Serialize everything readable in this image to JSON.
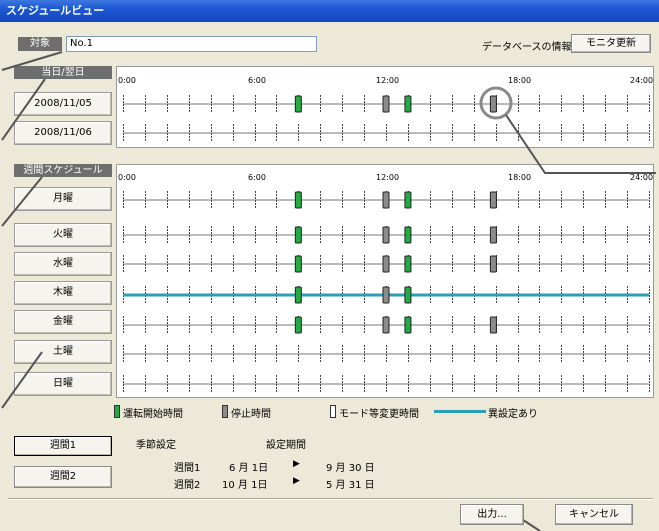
{
  "window": {
    "title": "スケジュールビュー"
  },
  "header": {
    "target_label": "対象",
    "target_value": "No.1",
    "db_info_label": "データベースの情報",
    "monitor_update_button": "モニタ更新"
  },
  "time_axis": {
    "ticks": [
      "0:00",
      "6:00",
      "12:00",
      "18:00",
      "24:00"
    ]
  },
  "today_section": {
    "label": "当日/翌日",
    "rows": [
      {
        "label": "2008/11/05",
        "events": [
          {
            "type": "start",
            "hour": 8.0
          },
          {
            "type": "stop",
            "hour": 12.0
          },
          {
            "type": "start",
            "hour": 13.0
          },
          {
            "type": "stop",
            "hour": 16.9
          }
        ]
      },
      {
        "label": "2008/11/06",
        "events": []
      }
    ]
  },
  "weekly_section": {
    "label": "週間スケジュール",
    "rows": [
      {
        "label": "月曜",
        "events": [
          {
            "type": "start",
            "hour": 8.0
          },
          {
            "type": "stop",
            "hour": 12.0
          },
          {
            "type": "start",
            "hour": 13.0
          },
          {
            "type": "stop",
            "hour": 16.9
          }
        ]
      },
      {
        "label": "火曜",
        "events": [
          {
            "type": "start",
            "hour": 8.0
          },
          {
            "type": "stop",
            "hour": 12.0
          },
          {
            "type": "start",
            "hour": 13.0
          },
          {
            "type": "stop",
            "hour": 16.9
          }
        ]
      },
      {
        "label": "水曜",
        "events": [
          {
            "type": "start",
            "hour": 8.0
          },
          {
            "type": "stop",
            "hour": 12.0
          },
          {
            "type": "start",
            "hour": 13.0
          },
          {
            "type": "stop",
            "hour": 16.9
          }
        ]
      },
      {
        "label": "木曜",
        "abnormal": true,
        "events": [
          {
            "type": "start",
            "hour": 8.0
          },
          {
            "type": "stop",
            "hour": 12.0
          },
          {
            "type": "start",
            "hour": 13.0
          }
        ]
      },
      {
        "label": "金曜",
        "events": [
          {
            "type": "start",
            "hour": 8.0
          },
          {
            "type": "stop",
            "hour": 12.0
          },
          {
            "type": "start",
            "hour": 13.0
          },
          {
            "type": "stop",
            "hour": 16.9
          }
        ]
      },
      {
        "label": "土曜",
        "events": []
      },
      {
        "label": "日曜",
        "events": []
      }
    ]
  },
  "legend": {
    "start": "運転開始時間",
    "stop": "停止時間",
    "mode_change": "モード等変更時間",
    "abnormal": "異設定あり"
  },
  "week_buttons": [
    "週間1",
    "週間2"
  ],
  "season": {
    "label": "季節設定",
    "period_label": "設定期間",
    "rows": [
      {
        "name": "週間1",
        "start": "6 月  1日",
        "arrow": "▶",
        "end": "9 月 30 日"
      },
      {
        "name": "週間2",
        "start": "10 月  1日",
        "arrow": "▶",
        "end": "5 月 31 日"
      }
    ]
  },
  "footer": {
    "output_button": "出力...",
    "cancel_button": "キャンセル"
  },
  "colors": {
    "start": "#22aa44",
    "stop": "#8c8c8c",
    "abnormal": "#2a9fb5",
    "title_bar": "#1c57d2"
  }
}
